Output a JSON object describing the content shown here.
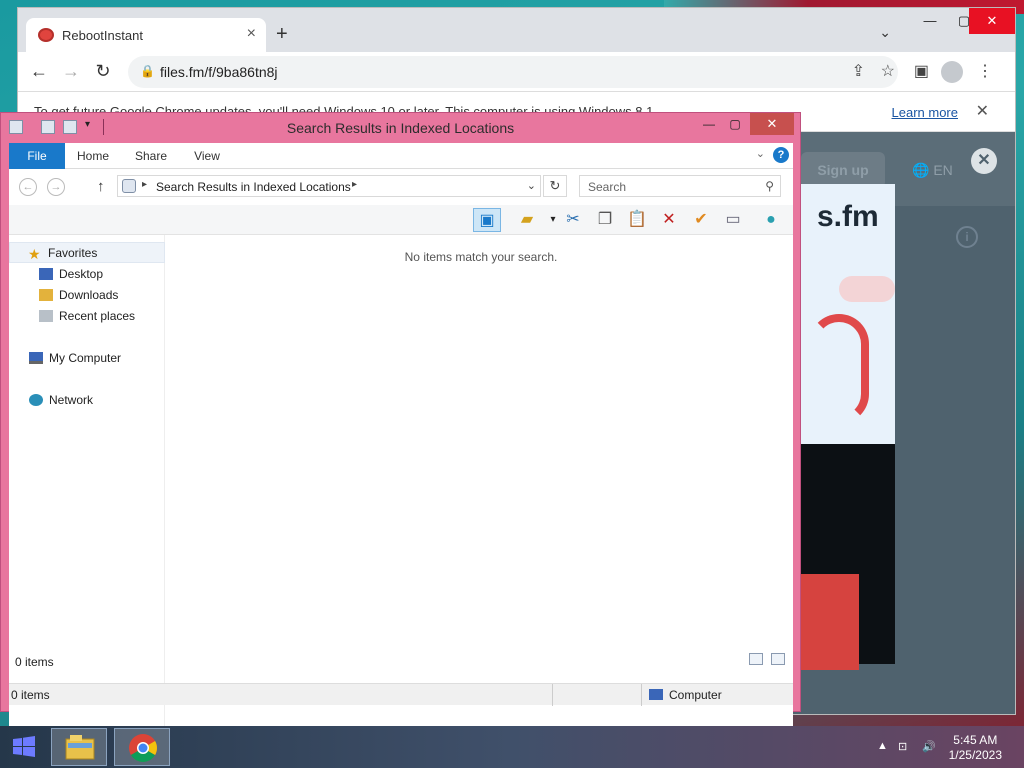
{
  "chrome": {
    "tab_title": "RebootInstant",
    "tab_close": "×",
    "new_tab": "+",
    "tab_search": "⌄",
    "win_min": "—",
    "win_max": "▢",
    "win_close": "✕",
    "url": "files.fm/f/9ba86tn8j",
    "info_message": "To get future Google Chrome updates, you'll need Windows 10 or later. This computer is using Windows 8.1.",
    "info_learn_more": "Learn more",
    "info_close": "✕"
  },
  "website": {
    "signup": "Sign up",
    "lang": "EN",
    "close": "✕",
    "logo_text": "s.fm",
    "info": "i"
  },
  "explorer": {
    "title": "Search Results in Indexed Locations",
    "ribbon_tabs": [
      "File",
      "Home",
      "Share",
      "View"
    ],
    "help": "?",
    "breadcrumb": "Search Results in Indexed Locations",
    "search_placeholder": "Search",
    "nav": {
      "favorites": "Favorites",
      "desktop": "Desktop",
      "downloads": "Downloads",
      "recent": "Recent places",
      "computer": "My Computer",
      "network": "Network"
    },
    "empty_message": "No items match your search.",
    "items_count": "0 items",
    "status_items": "0 items",
    "status_location": "Computer"
  },
  "taskbar": {
    "time": "5:45 AM",
    "date": "1/25/2023"
  },
  "colors": {
    "explorer_frame": "#e8769e",
    "ribbon_file": "#1979ca",
    "close_red": "#e81123"
  }
}
